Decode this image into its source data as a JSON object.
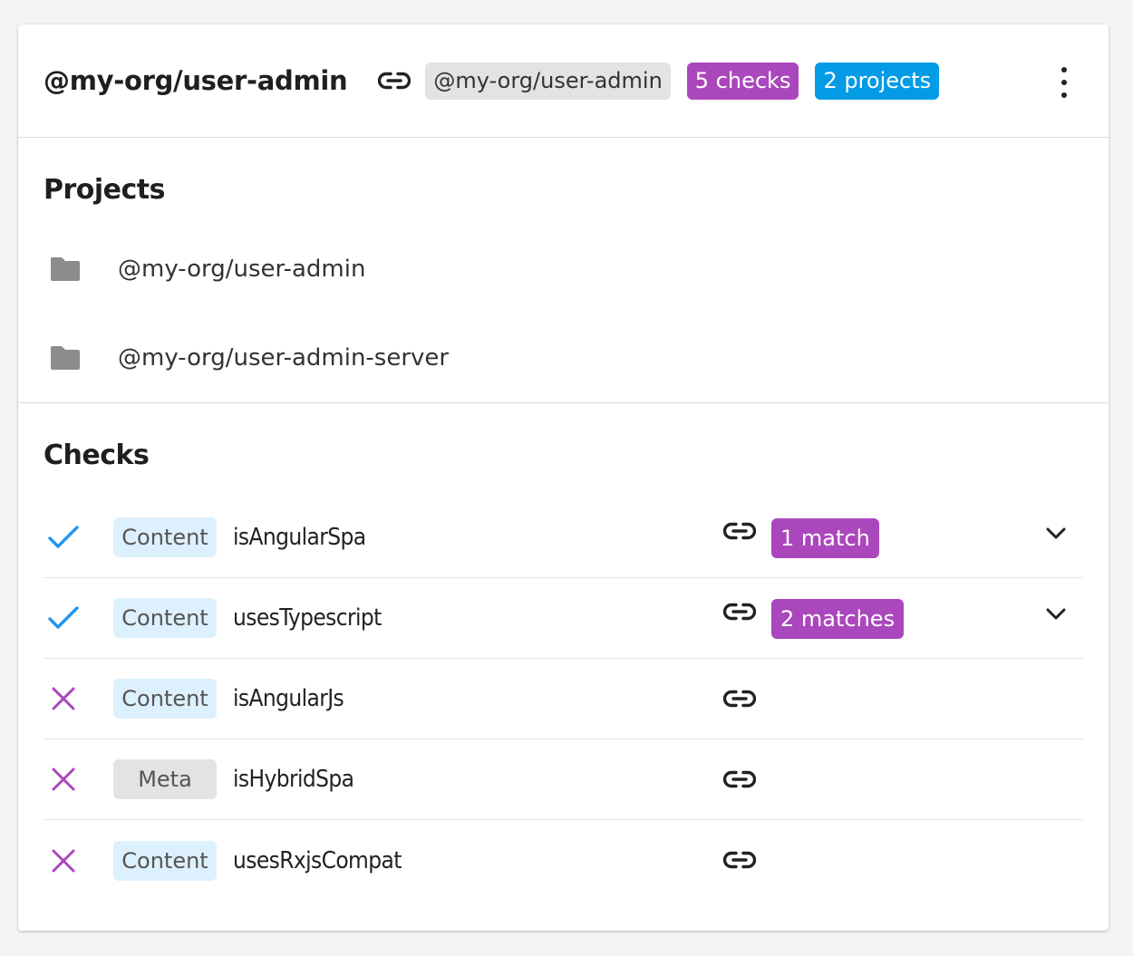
{
  "header": {
    "title": "@my-org/user-admin",
    "package_chip": "@my-org/user-admin",
    "checks_badge": "5 checks",
    "projects_badge": "2 projects"
  },
  "projects": {
    "title": "Projects",
    "items": [
      {
        "name": "@my-org/user-admin"
      },
      {
        "name": "@my-org/user-admin-server"
      }
    ]
  },
  "checks": {
    "title": "Checks",
    "items": [
      {
        "status": "pass",
        "type": "Content",
        "name": "isAngularSpa",
        "matches": "1 match"
      },
      {
        "status": "pass",
        "type": "Content",
        "name": "usesTypescript",
        "matches": "2 matches"
      },
      {
        "status": "fail",
        "type": "Content",
        "name": "isAngularJs",
        "matches": ""
      },
      {
        "status": "fail",
        "type": "Meta",
        "name": "isHybridSpa",
        "matches": ""
      },
      {
        "status": "fail",
        "type": "Content",
        "name": "usesRxjsCompat",
        "matches": ""
      }
    ]
  },
  "icons": {
    "link": "link-icon",
    "more": "more-vert-icon",
    "folder": "folder-icon",
    "pass": "check-icon",
    "fail": "close-icon",
    "expand": "chevron-down-icon"
  },
  "colors": {
    "purple": "#ab47bc",
    "blue": "#039be5",
    "check_blue": "#2196f3",
    "content_chip": "#ddf0fd",
    "meta_chip": "#e3e3e3"
  }
}
